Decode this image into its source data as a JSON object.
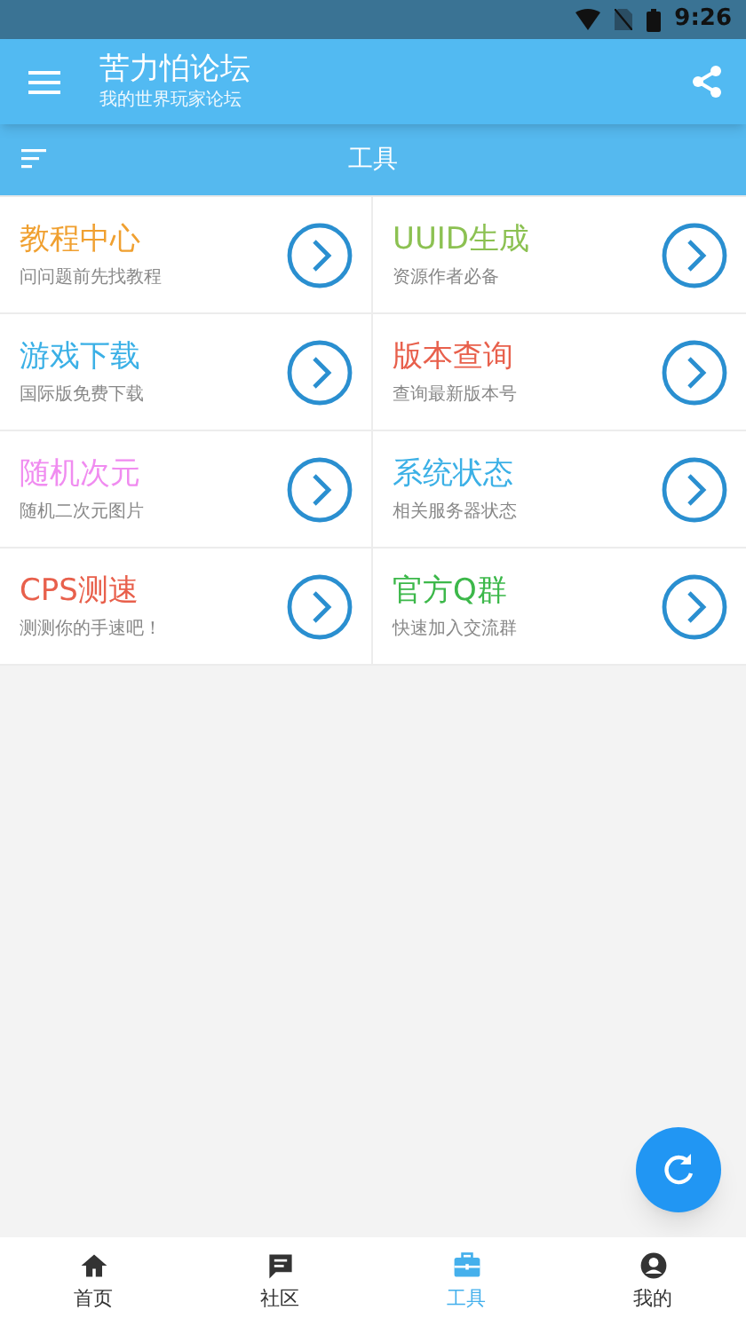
{
  "status_bar": {
    "time": "9:26"
  },
  "app_bar": {
    "title": "苦力怕论坛",
    "subtitle": "我的世界玩家论坛"
  },
  "section_bar": {
    "title": "工具"
  },
  "tools": [
    {
      "title": "教程中心",
      "subtitle": "问问题前先找教程",
      "color": "#f0a030"
    },
    {
      "title": "UUID生成",
      "subtitle": "资源作者必备",
      "color": "#8cc152"
    },
    {
      "title": "游戏下载",
      "subtitle": "国际版免费下载",
      "color": "#3bb0e6"
    },
    {
      "title": "版本查询",
      "subtitle": "查询最新版本号",
      "color": "#e8604c"
    },
    {
      "title": "随机次元",
      "subtitle": "随机二次元图片",
      "color": "#f08cf0"
    },
    {
      "title": "系统状态",
      "subtitle": "相关服务器状态",
      "color": "#3bb0e6"
    },
    {
      "title": "CPS测速",
      "subtitle": "测测你的手速吧！",
      "color": "#e8604c"
    },
    {
      "title": "官方Q群",
      "subtitle": "快速加入交流群",
      "color": "#3cb84a"
    }
  ],
  "bottom_nav": [
    {
      "label": "首页",
      "kind": "home",
      "selected": false
    },
    {
      "label": "社区",
      "kind": "chat",
      "selected": false
    },
    {
      "label": "工具",
      "kind": "toolbox",
      "selected": true
    },
    {
      "label": "我的",
      "kind": "profile",
      "selected": false
    }
  ]
}
